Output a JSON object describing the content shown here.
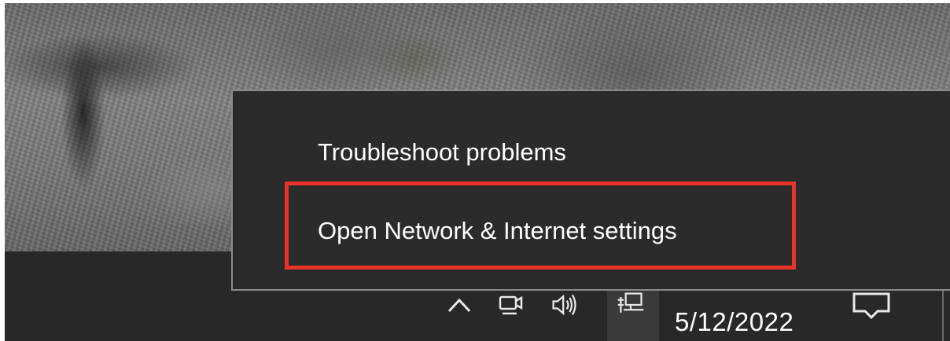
{
  "context_menu": {
    "items": [
      {
        "label": "Troubleshoot problems"
      },
      {
        "label": "Open Network & Internet settings"
      }
    ],
    "highlighted_item": "Open Network & Internet settings",
    "highlight_color": "#e8342a"
  },
  "taskbar": {
    "tray_icons": [
      {
        "icon": "chevron-up-icon"
      },
      {
        "icon": "meet-now-camera-icon"
      },
      {
        "icon": "speaker-volume-icon"
      },
      {
        "icon": "network-ethernet-icon"
      }
    ],
    "clock": {
      "date": "5/12/2022"
    },
    "action_center_icon": "notification-icon"
  },
  "colors": {
    "taskbar_bg": "#28282a",
    "menu_bg": "#2b2b2b",
    "menu_border": "#8a8a8a",
    "text": "#ffffff"
  }
}
